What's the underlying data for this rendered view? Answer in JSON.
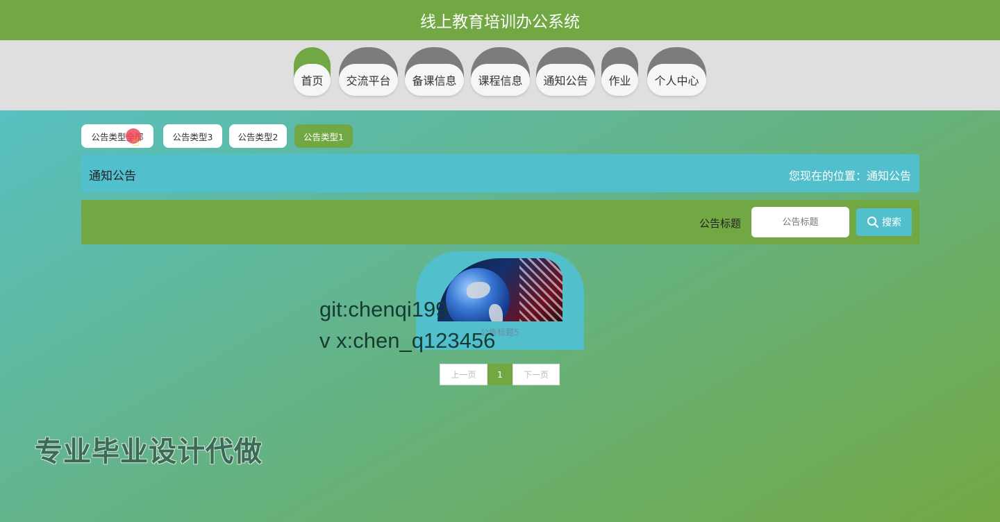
{
  "header": {
    "title": "线上教育培训办公系统"
  },
  "nav": {
    "items": [
      {
        "label": "首页",
        "active": true
      },
      {
        "label": "交流平台",
        "active": false
      },
      {
        "label": "备课信息",
        "active": false
      },
      {
        "label": "课程信息",
        "active": false
      },
      {
        "label": "通知公告",
        "active": false
      },
      {
        "label": "作业",
        "active": false
      },
      {
        "label": "个人中心",
        "active": false
      }
    ]
  },
  "type_tabs": [
    {
      "label": "公告类型全部",
      "active": false
    },
    {
      "label": "公告类型3",
      "active": false
    },
    {
      "label": "公告类型2",
      "active": false
    },
    {
      "label": "公告类型1",
      "active": true
    }
  ],
  "section": {
    "title": "通知公告",
    "breadcrumb_prefix": "您现在的位置：",
    "breadcrumb_current": "通知公告"
  },
  "search": {
    "label": "公告标题",
    "placeholder": "公告标题",
    "value": "",
    "button_label": "搜索"
  },
  "cards": [
    {
      "title": "公告标题5",
      "image": "news-broadcast-globe-image"
    }
  ],
  "pagination": {
    "prev": "上一页",
    "current": "1",
    "next": "下一页"
  },
  "watermark": {
    "line1": "git:chenqi199",
    "line2": "v x:chen_q123456",
    "big": "专业毕业设计代做"
  },
  "colors": {
    "brand_green": "#72a843",
    "accent_cyan": "#52c0cc",
    "nav_bg": "#e0dfe0"
  }
}
